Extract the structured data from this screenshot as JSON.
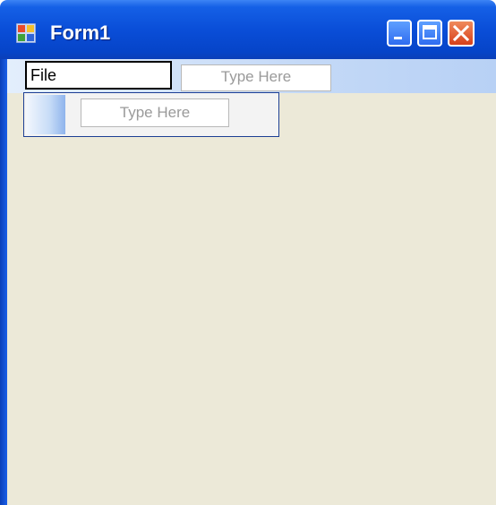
{
  "window": {
    "title": "Form1",
    "app_icon": "form-app-icon",
    "buttons": {
      "minimize": "minimize-icon",
      "maximize": "maximize-icon",
      "close": "close-icon"
    }
  },
  "menu": {
    "file_value": "File",
    "top_placeholder": "Type Here"
  },
  "dropdown": {
    "item_placeholder": "Type Here"
  },
  "colors": {
    "titlebar": "#0a4ed8",
    "client": "#ece9d8",
    "close_button": "#d8401a"
  }
}
